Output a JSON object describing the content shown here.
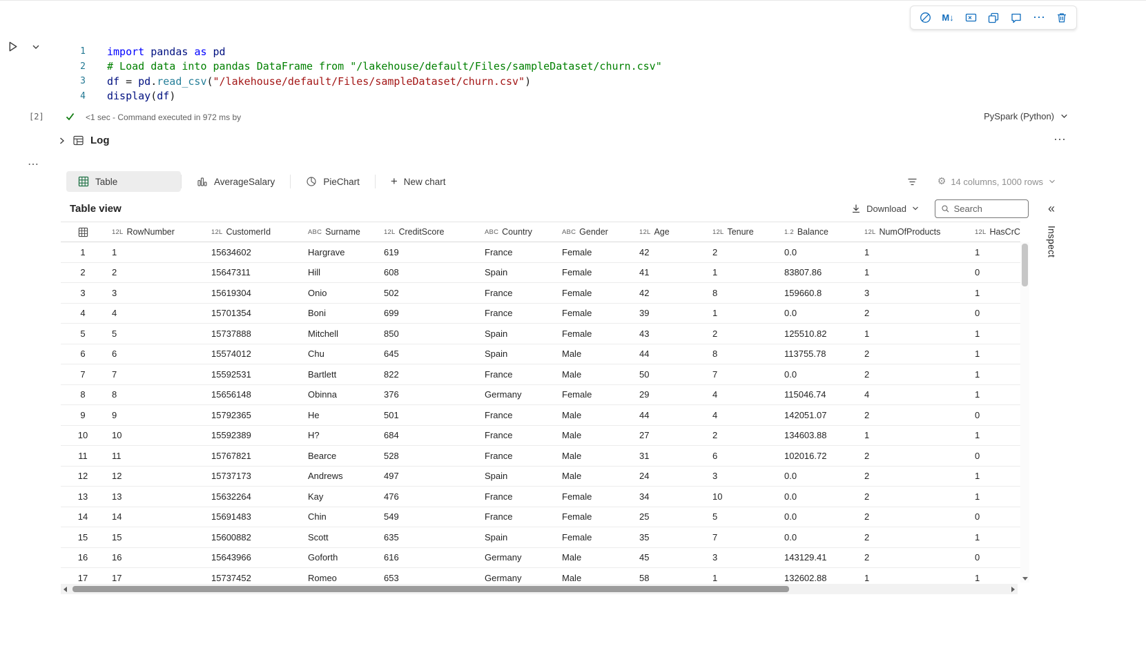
{
  "colors": {
    "toolbar_icon": "#0f6cbd",
    "success_check": "#0f7b0f",
    "keyword": "#0000ff",
    "comment": "#008000",
    "string": "#a31515",
    "table_tab_icon": "#217346",
    "active_tab_bg": "#ededed"
  },
  "icons": {
    "markdown": "M↓",
    "more": "⋯",
    "plus": "+",
    "gear": "⚙",
    "double_chevron_left": "«"
  },
  "code": {
    "lines": [
      {
        "n": "1",
        "tokens": [
          [
            "kw",
            "import "
          ],
          [
            "id",
            "pandas "
          ],
          [
            "kw",
            "as "
          ],
          [
            "id",
            "pd"
          ]
        ]
      },
      {
        "n": "2",
        "tokens": [
          [
            "cm",
            "# Load data into pandas DataFrame from \"/lakehouse/default/Files/sampleDataset/churn.csv\""
          ]
        ]
      },
      {
        "n": "3",
        "tokens": [
          [
            "id",
            "df "
          ],
          [
            "pl",
            "= "
          ],
          [
            "id",
            "pd"
          ],
          [
            "pl",
            "."
          ],
          [
            "fn",
            "read_csv"
          ],
          [
            "pl",
            "("
          ],
          [
            "st",
            "\"/lakehouse/default/Files/sampleDataset/churn.csv\""
          ],
          [
            "pl",
            ")"
          ]
        ]
      },
      {
        "n": "4",
        "tokens": [
          [
            "id",
            "display"
          ],
          [
            "pl",
            "("
          ],
          [
            "id",
            "df"
          ],
          [
            "pl",
            ")"
          ]
        ]
      }
    ]
  },
  "status": {
    "execution_count": "[2]",
    "message": "<1 sec - Command executed in 972 ms by",
    "kernel_label": "PySpark (Python)"
  },
  "results": {
    "log_label": "Log",
    "tabs": [
      {
        "label": "Table",
        "active": true
      },
      {
        "label": "AverageSalary",
        "active": false
      },
      {
        "label": "PieChart",
        "active": false
      }
    ],
    "new_chart_label": "New chart",
    "columns_summary": "14 columns, 1000 rows",
    "view_title": "Table view",
    "download_label": "Download",
    "search_placeholder": "Search",
    "inspect_label": "Inspect"
  },
  "table": {
    "columns": [
      {
        "type": "12L",
        "label": "RowNumber"
      },
      {
        "type": "12L",
        "label": "CustomerId"
      },
      {
        "type": "ABC",
        "label": "Surname"
      },
      {
        "type": "12L",
        "label": "CreditScore"
      },
      {
        "type": "ABC",
        "label": "Country"
      },
      {
        "type": "ABC",
        "label": "Gender"
      },
      {
        "type": "12L",
        "label": "Age"
      },
      {
        "type": "12L",
        "label": "Tenure"
      },
      {
        "type": "1.2",
        "label": "Balance"
      },
      {
        "type": "12L",
        "label": "NumOfProducts"
      },
      {
        "type": "12L",
        "label": "HasCrCard"
      }
    ],
    "rows": [
      [
        1,
        15634602,
        "Hargrave",
        619,
        "France",
        "Female",
        42,
        2,
        "0.0",
        1,
        1
      ],
      [
        2,
        15647311,
        "Hill",
        608,
        "Spain",
        "Female",
        41,
        1,
        "83807.86",
        1,
        0
      ],
      [
        3,
        15619304,
        "Onio",
        502,
        "France",
        "Female",
        42,
        8,
        "159660.8",
        3,
        1
      ],
      [
        4,
        15701354,
        "Boni",
        699,
        "France",
        "Female",
        39,
        1,
        "0.0",
        2,
        0
      ],
      [
        5,
        15737888,
        "Mitchell",
        850,
        "Spain",
        "Female",
        43,
        2,
        "125510.82",
        1,
        1
      ],
      [
        6,
        15574012,
        "Chu",
        645,
        "Spain",
        "Male",
        44,
        8,
        "113755.78",
        2,
        1
      ],
      [
        7,
        15592531,
        "Bartlett",
        822,
        "France",
        "Male",
        50,
        7,
        "0.0",
        2,
        1
      ],
      [
        8,
        15656148,
        "Obinna",
        376,
        "Germany",
        "Female",
        29,
        4,
        "115046.74",
        4,
        1
      ],
      [
        9,
        15792365,
        "He",
        501,
        "France",
        "Male",
        44,
        4,
        "142051.07",
        2,
        0
      ],
      [
        10,
        15592389,
        "H?",
        684,
        "France",
        "Male",
        27,
        2,
        "134603.88",
        1,
        1
      ],
      [
        11,
        15767821,
        "Bearce",
        528,
        "France",
        "Male",
        31,
        6,
        "102016.72",
        2,
        0
      ],
      [
        12,
        15737173,
        "Andrews",
        497,
        "Spain",
        "Male",
        24,
        3,
        "0.0",
        2,
        1
      ],
      [
        13,
        15632264,
        "Kay",
        476,
        "France",
        "Female",
        34,
        10,
        "0.0",
        2,
        1
      ],
      [
        14,
        15691483,
        "Chin",
        549,
        "France",
        "Female",
        25,
        5,
        "0.0",
        2,
        0
      ],
      [
        15,
        15600882,
        "Scott",
        635,
        "Spain",
        "Female",
        35,
        7,
        "0.0",
        2,
        1
      ],
      [
        16,
        15643966,
        "Goforth",
        616,
        "Germany",
        "Male",
        45,
        3,
        "143129.41",
        2,
        0
      ],
      [
        17,
        15737452,
        "Romeo",
        653,
        "Germany",
        "Male",
        58,
        1,
        "132602.88",
        1,
        1
      ]
    ]
  }
}
